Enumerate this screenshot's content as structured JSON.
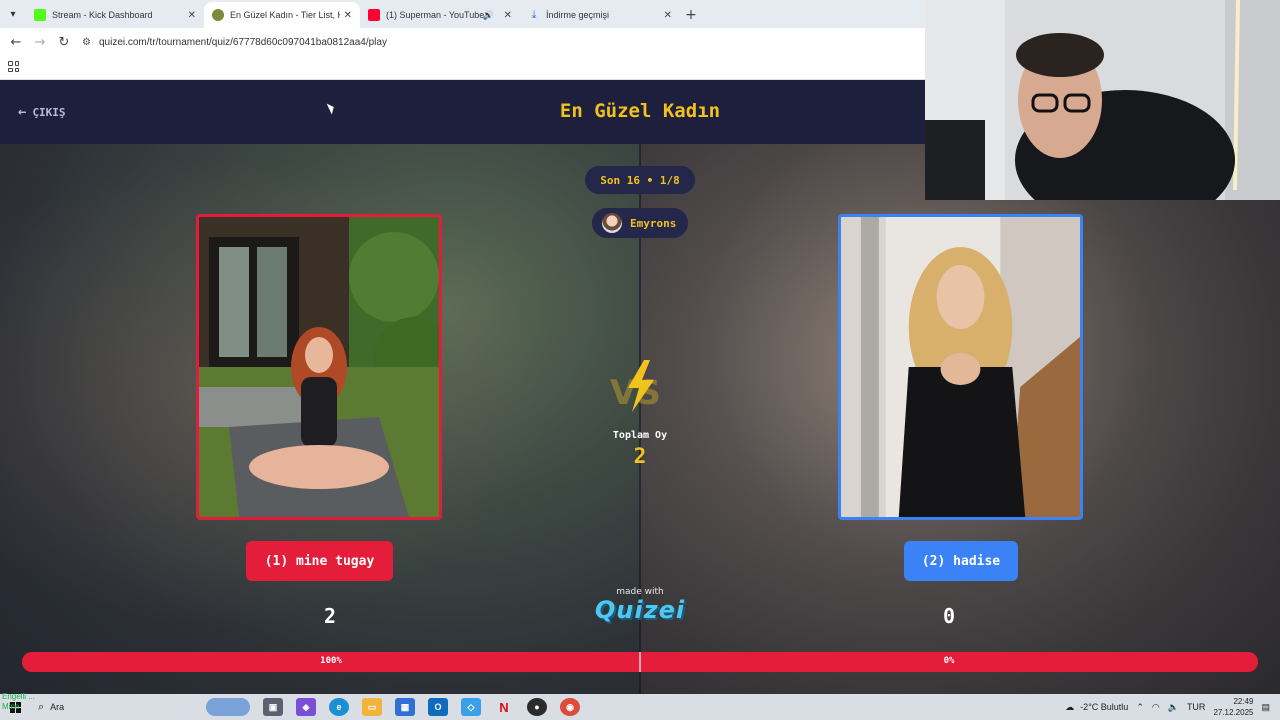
{
  "browser": {
    "tabs": [
      {
        "title": "Stream - Kick Dashboard",
        "active": false,
        "favicon_color": "#53fc18"
      },
      {
        "title": "En Güzel Kadın - Tier List, Kör S",
        "active": true,
        "favicon_color": "#7b8a3e"
      },
      {
        "title": "(1) Superman - YouTube",
        "active": false,
        "favicon_color": "#ff0033"
      },
      {
        "title": "İndirme geçmişi",
        "active": false,
        "favicon_color": "#1a73e8"
      }
    ],
    "url": "quizei.com/tr/tournament/quiz/67778d60c097041ba0812aa4/play"
  },
  "header": {
    "exit_label": "ÇIKIŞ",
    "title": "En Güzel Kadın"
  },
  "arena": {
    "round": "Son 16 • 1/8",
    "user": "Emyrons",
    "total_label": "Toplam Oy",
    "total_value": "2",
    "left": {
      "name": "(1) mine tugay",
      "score": "2",
      "percent_label": "100%",
      "percent": 100,
      "color": "#e41d3b"
    },
    "right": {
      "name": "(2) hadise",
      "score": "0",
      "percent_label": "0%",
      "percent": 0,
      "color": "#3b82f6"
    },
    "made_with": "made with",
    "brand": "Quizei"
  },
  "taskbar": {
    "search_label": "Ara",
    "weather": "-2°C Bulutlu",
    "language": "TUR",
    "time": "22:49",
    "date": "27.12.2025",
    "overlay_line1": "Engelli ...",
    "overlay_line2": "Mine"
  }
}
